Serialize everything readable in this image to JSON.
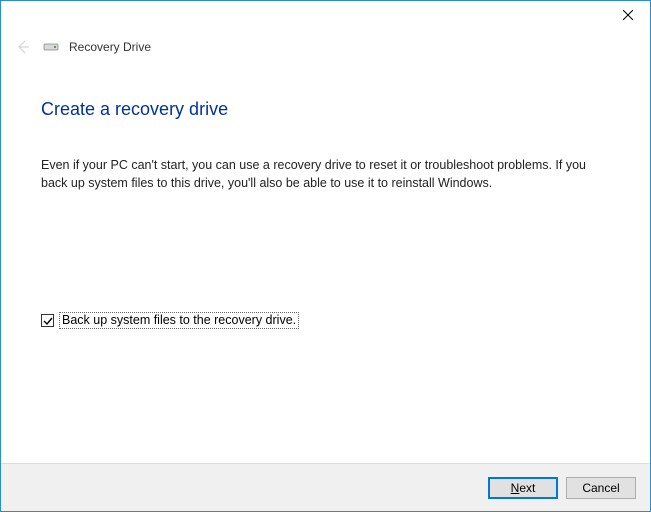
{
  "header": {
    "title": "Recovery Drive"
  },
  "page": {
    "heading": "Create a recovery drive",
    "body": "Even if your PC can't start, you can use a recovery drive to reset it or troubleshoot problems. If you back up system files to this drive, you'll also be able to use it to reinstall Windows."
  },
  "checkbox": {
    "checked": true,
    "label": "Back up system files to the recovery drive."
  },
  "footer": {
    "next_prefix": "N",
    "next_suffix": "ext",
    "cancel": "Cancel"
  }
}
